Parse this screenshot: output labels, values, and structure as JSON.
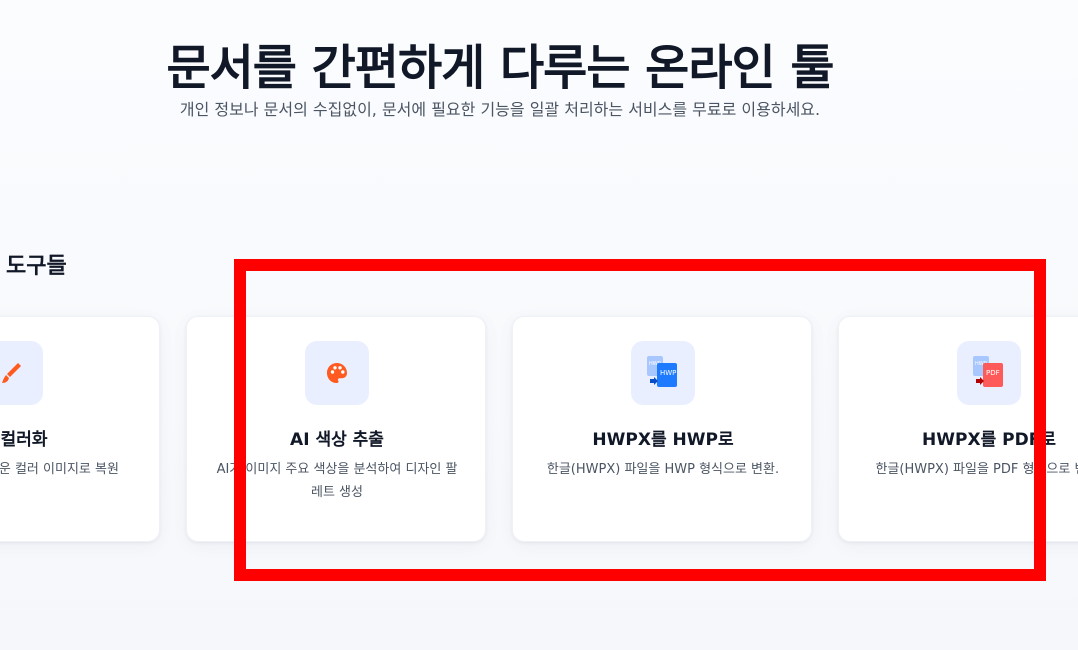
{
  "hero": {
    "title": "문서를 간편하게 다루는 온라인 툴",
    "subtitle": "개인 정보나 문서의 수집없이, 문서에 필요한 기능을 일괄 처리하는 서비스를 무료로 이용하세요."
  },
  "section": {
    "title": "도구들"
  },
  "cards": [
    {
      "title": "지 컬러화",
      "desc": "연스러운 컬러 이미지로 복원",
      "icon": "brush-icon"
    },
    {
      "title": "AI 색상 추출",
      "desc": "AI가 이미지 주요 색상을 분석하여 디자인 팔레트 생성",
      "icon": "palette-icon"
    },
    {
      "title": "HWPX를 HWP로",
      "desc": "한글(HWPX) 파일을 HWP 형식으로 변환.",
      "icon": "hwp-convert-icon"
    },
    {
      "title": "HWPX를 PDF로",
      "desc": "한글(HWPX) 파일을 PDF 형식으로 변환.",
      "icon": "pdf-convert-icon"
    }
  ],
  "colors": {
    "accent": "#ff5a1f",
    "icon_bg": "#e9efff",
    "highlight": "#ff0000"
  }
}
